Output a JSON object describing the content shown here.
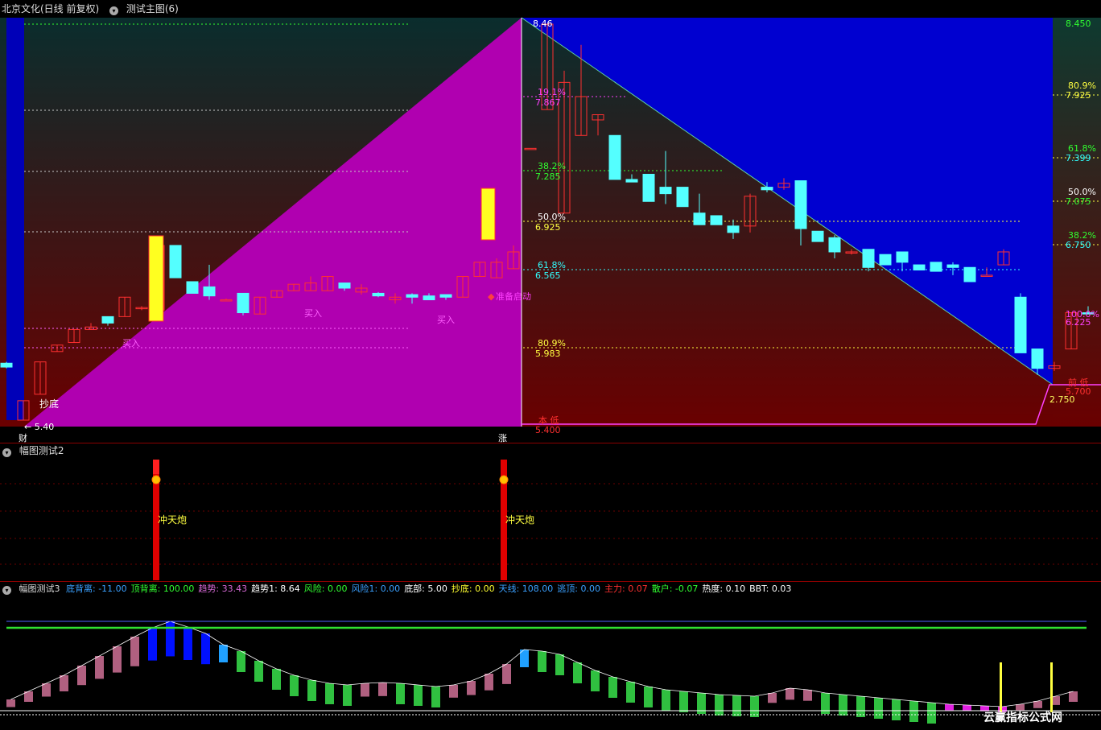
{
  "panel1": {
    "title": "北京文化(日线 前复权)",
    "tab": "测试主图(6)",
    "top_price": "8.450",
    "right_price_top": "8.450",
    "peak_label": "8.46",
    "low_left_label": "← 5.40",
    "chaodi_label": "抄底",
    "buy_labels": [
      "买入",
      "买入",
      "买入"
    ],
    "start_label": "准备启动",
    "bottom_left_mark": "财",
    "bottom_mid_mark": "涨",
    "low_mid": {
      "text": "本 低",
      "price": "5.400"
    },
    "low_right": {
      "text": "前 低",
      "price": "5.700"
    },
    "right_low_price": "2.750",
    "right_last_price": "6.225",
    "right_last_pct": "100.0%",
    "fib_mid": [
      {
        "pct": "19.1%",
        "price": "7.867"
      },
      {
        "pct": "38.2%",
        "price": "7.285"
      },
      {
        "pct": "50.0%",
        "price": "6.925"
      },
      {
        "pct": "61.8%",
        "price": "6.565"
      },
      {
        "pct": "80.9%",
        "price": "5.983"
      }
    ],
    "fib_right": [
      {
        "pct": "80.9%",
        "price": "7.925"
      },
      {
        "pct": "61.8%",
        "price": "7.399"
      },
      {
        "pct": "50.0%",
        "price": "7.075"
      },
      {
        "pct": "38.2%",
        "price": "6.750"
      }
    ]
  },
  "panel2": {
    "title": "幅图测试2",
    "signals": [
      "冲天炮",
      "冲天炮"
    ]
  },
  "panel3": {
    "title": "幅图测试3",
    "indicators": [
      {
        "name": "底背离",
        "value": "-11.00",
        "color": "#3aa0ff"
      },
      {
        "name": "顶背离",
        "value": "100.00",
        "color": "#30ff30"
      },
      {
        "name": "趋势",
        "value": "33.43",
        "color": "#d86ad8"
      },
      {
        "name": "趋势1",
        "value": "8.64",
        "color": "#ffffff"
      },
      {
        "name": "风险",
        "value": "0.00",
        "color": "#30ff30"
      },
      {
        "name": "风险1",
        "value": "0.00",
        "color": "#3aa0ff"
      },
      {
        "name": "底部",
        "value": "5.00",
        "color": "#ffffff"
      },
      {
        "name": "抄底",
        "value": "0.00",
        "color": "#ffff30"
      },
      {
        "name": "天线",
        "value": "108.00",
        "color": "#3aa0ff"
      },
      {
        "name": "逃顶",
        "value": "0.00",
        "color": "#3aa0ff"
      },
      {
        "name": "主力",
        "value": "0.07",
        "color": "#ff3030"
      },
      {
        "name": "散户",
        "value": "-0.07",
        "color": "#30ff30"
      },
      {
        "name": "热度",
        "value": "0.10",
        "color": "#ffffff"
      },
      {
        "name": "BBT",
        "value": "0.03",
        "color": "#ffffff"
      }
    ],
    "watermark": "云赢指标公式网"
  },
  "colors": {
    "up": "#ff3030",
    "down": "#54ffff",
    "magenta": "#b000b0",
    "blue": "#0000d0",
    "fib": "#ffff30"
  },
  "chart_data": {
    "type": "candlestick",
    "ylim": [
      5.4,
      8.46
    ],
    "candles": [
      [
        5.84,
        5.85,
        5.8,
        5.81
      ],
      [
        5.4,
        5.55,
        5.4,
        5.55
      ],
      [
        5.6,
        5.85,
        5.6,
        5.85
      ],
      [
        5.93,
        5.98,
        5.93,
        5.98
      ],
      [
        6.0,
        6.1,
        6.0,
        6.1
      ],
      [
        6.1,
        6.15,
        6.1,
        6.12
      ],
      [
        6.2,
        6.2,
        6.13,
        6.15
      ],
      [
        6.2,
        6.35,
        6.2,
        6.35
      ],
      [
        6.27,
        6.28,
        6.25,
        6.27
      ],
      [
        6.25,
        6.75,
        6.25,
        6.75
      ],
      [
        6.75,
        6.75,
        6.5,
        6.5
      ],
      [
        6.47,
        6.47,
        6.38,
        6.38
      ],
      [
        6.43,
        6.6,
        6.33,
        6.36
      ],
      [
        6.33,
        6.34,
        6.33,
        6.33
      ],
      [
        6.38,
        6.38,
        6.21,
        6.23
      ],
      [
        6.22,
        6.35,
        6.22,
        6.35
      ],
      [
        6.35,
        6.4,
        6.35,
        6.4
      ],
      [
        6.4,
        6.45,
        6.4,
        6.45
      ],
      [
        6.4,
        6.51,
        6.4,
        6.46
      ],
      [
        6.4,
        6.51,
        6.4,
        6.51
      ],
      [
        6.46,
        6.46,
        6.4,
        6.42
      ],
      [
        6.39,
        6.45,
        6.37,
        6.42
      ],
      [
        6.38,
        6.39,
        6.35,
        6.36
      ],
      [
        6.33,
        6.38,
        6.3,
        6.35
      ],
      [
        6.37,
        6.38,
        6.3,
        6.35
      ],
      [
        6.36,
        6.38,
        6.33,
        6.33
      ],
      [
        6.37,
        6.37,
        6.33,
        6.35
      ],
      [
        6.35,
        6.51,
        6.35,
        6.51
      ],
      [
        6.51,
        6.62,
        6.51,
        6.62
      ],
      [
        6.5,
        6.65,
        6.5,
        6.62
      ],
      [
        6.57,
        6.75,
        6.57,
        6.7
      ],
      [
        7.5,
        7.5,
        7.5,
        7.5
      ],
      [
        7.8,
        8.46,
        7.8,
        8.46
      ],
      [
        7.0,
        8.1,
        7.0,
        8.01
      ],
      [
        7.6,
        8.3,
        7.6,
        7.9
      ],
      [
        7.72,
        7.76,
        7.6,
        7.76
      ],
      [
        7.6,
        7.44,
        7.44,
        7.26
      ],
      [
        7.26,
        7.3,
        7.24,
        7.24
      ],
      [
        7.3,
        7.09,
        7.09,
        7.09
      ],
      [
        7.2,
        7.48,
        7.07,
        7.15
      ],
      [
        7.2,
        7.05,
        7.05,
        7.05
      ],
      [
        7.0,
        7.15,
        6.95,
        6.91
      ],
      [
        6.98,
        6.95,
        6.93,
        6.91
      ],
      [
        6.9,
        6.95,
        6.8,
        6.85
      ],
      [
        6.9,
        7.15,
        6.85,
        7.13
      ],
      [
        7.2,
        7.24,
        7.16,
        7.18
      ],
      [
        7.2,
        7.27,
        7.18,
        7.23
      ],
      [
        7.25,
        7.25,
        6.75,
        6.88
      ],
      [
        6.86,
        6.86,
        6.8,
        6.78
      ],
      [
        6.81,
        6.83,
        6.65,
        6.7
      ],
      [
        6.7,
        6.72,
        6.68,
        6.7
      ],
      [
        6.72,
        6.7,
        6.55,
        6.58
      ],
      [
        6.68,
        6.68,
        6.6,
        6.6
      ],
      [
        6.7,
        6.62,
        6.55,
        6.62
      ],
      [
        6.6,
        6.57,
        6.56,
        6.56
      ],
      [
        6.62,
        6.62,
        6.55,
        6.55
      ],
      [
        6.6,
        6.62,
        6.52,
        6.58
      ],
      [
        6.58,
        6.53,
        6.47,
        6.47
      ],
      [
        6.52,
        6.58,
        6.52,
        6.52
      ],
      [
        6.6,
        6.72,
        6.6,
        6.7
      ],
      [
        6.35,
        6.38,
        5.92,
        5.92
      ],
      [
        5.95,
        5.95,
        5.75,
        5.8
      ],
      [
        5.8,
        5.85,
        5.78,
        5.82
      ],
      [
        5.95,
        6.23,
        5.95,
        6.23
      ],
      [
        6.23,
        6.28,
        6.22,
        6.22
      ]
    ]
  }
}
